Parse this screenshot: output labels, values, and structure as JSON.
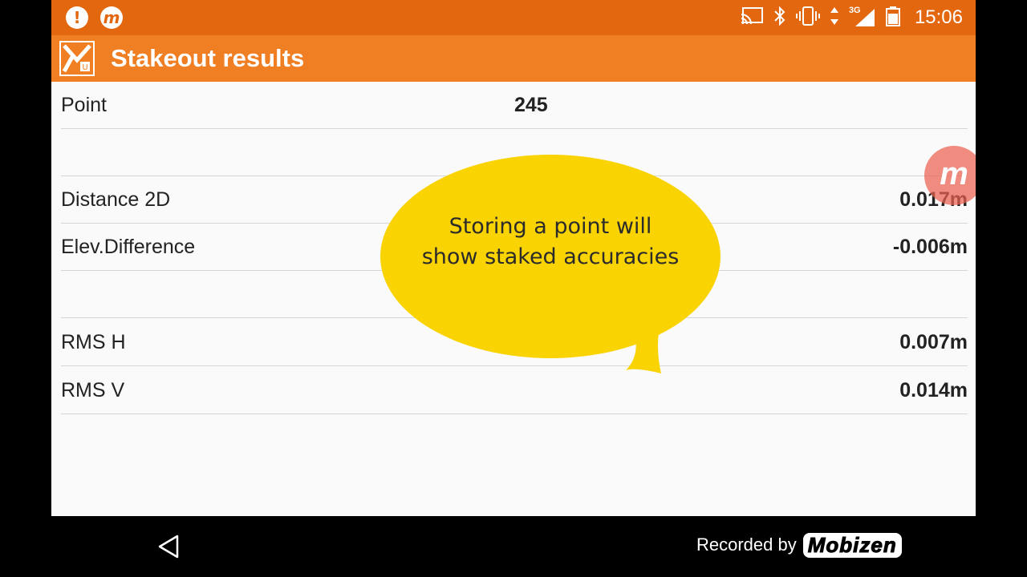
{
  "status_bar": {
    "time": "15:06",
    "network_label": "3G",
    "icons": [
      "alert-icon",
      "mobizen-notification-icon",
      "cast-icon",
      "bluetooth-icon",
      "vibrate-icon",
      "data-arrows-icon",
      "signal-icon",
      "battery-icon"
    ]
  },
  "app_bar": {
    "title": "Stakeout results",
    "logo_icon": "app-logo-icon"
  },
  "rows": [
    {
      "label": "Point",
      "value": "245"
    },
    {
      "label": "",
      "value": ""
    },
    {
      "label": "Distance 2D",
      "value": "0.017m"
    },
    {
      "label": "Elev.Difference",
      "value": "-0.006m"
    },
    {
      "label": "",
      "value": ""
    },
    {
      "label": "RMS H",
      "value": "0.007m"
    },
    {
      "label": "RMS V",
      "value": "0.014m"
    }
  ],
  "callout": {
    "line1": "Storing a point will",
    "line2": "show staked accuracies",
    "color": "#fad302"
  },
  "recorder_bubble": {
    "glyph": "m"
  },
  "nav_bar": {
    "watermark_text": "Recorded by",
    "watermark_logo": "Mobizen"
  },
  "colors": {
    "status_bar": "#e2670f",
    "app_bar": "#f07e22",
    "background": "#fafafa"
  }
}
